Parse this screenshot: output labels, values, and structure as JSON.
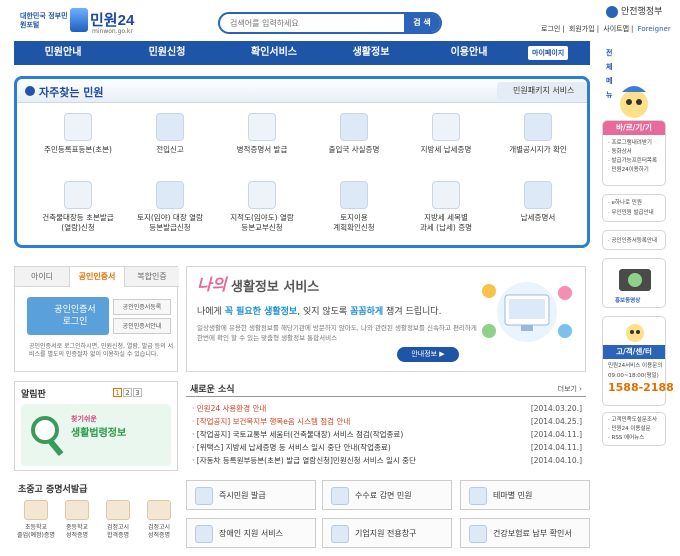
{
  "header": {
    "logo_small": "대한민국 정부민원포털",
    "logo_big": "민원24",
    "logo_url": "minwon.go.kr",
    "search_placeholder": "검색어를 입력하세요",
    "search_button": "검 색",
    "gov_name": "안전행정부",
    "top_links": [
      "로그인",
      "회원가입",
      "사이트맵",
      "Foreigner"
    ]
  },
  "nav": {
    "items": [
      "민원안내",
      "민원신청",
      "확인서비스",
      "생활정보",
      "이용안내"
    ],
    "my_page": "마이페이지",
    "all_menu": "전체메뉴"
  },
  "frequent": {
    "title": "자주찾는 민원",
    "package_link": "민원패키지 서비스",
    "services": [
      {
        "label": "주민등록표등본(초본)",
        "icon": "document-id-icon"
      },
      {
        "label": "전입신고",
        "icon": "house-move-icon"
      },
      {
        "label": "병적증명서 발급",
        "icon": "monitor-certificate-icon"
      },
      {
        "label": "출입국 사실증명",
        "icon": "airplane-icon"
      },
      {
        "label": "지방세 납세증명",
        "icon": "tax-doc-icon"
      },
      {
        "label": "개별공시지가 확인",
        "icon": "land-price-icon"
      },
      {
        "label": "건축물대장등 초본발급\n(열람)신청",
        "icon": "building-icon"
      },
      {
        "label": "토지(임야) 대장 열람\n등본발급신청",
        "icon": "land-search-icon"
      },
      {
        "label": "지적도(임야도) 열람\n등본교부신청",
        "icon": "map-monitor-icon"
      },
      {
        "label": "토지이용\n계획확인신청",
        "icon": "land-plan-icon"
      },
      {
        "label": "지방세 세목별\n과세 (납세) 증명",
        "icon": "money-stack-icon"
      },
      {
        "label": "납세증명서",
        "icon": "calculator-icon"
      }
    ]
  },
  "login": {
    "tabs": [
      "아이디",
      "공인인증서",
      "복합인증"
    ],
    "cert_login": "공인인증서\n로그인",
    "cert_register": "공인인증서등록",
    "cert_guide": "공인인증서안내",
    "note": "공인인증서로 로그인하시면, 민원신청, 열람, 발급 등의 서비스를 별도의 인증절차 없이 이용하실 수 있습니다."
  },
  "life_info": {
    "prefix": "나의",
    "title": "생활정보 서비스",
    "sub_before": "나에게 ",
    "sub_em1": "꼭 필요한 생활정보",
    "sub_mid": ", 잊지 않도록 ",
    "sub_em2": "꼼꼼하게",
    "sub_after": " 챙겨 드립니다.",
    "desc": "일상생활에 유용한 생활정보를 해당기관에 방문하지 않아도, 나와 관련된 생활정보를 신속하고 편리하게 한번에 확인 할 수 있는 맞춤형 생활정보 통합서비스",
    "more": "안내정보 ▶"
  },
  "notice": {
    "title": "알림판",
    "pages": [
      "1",
      "2",
      "3"
    ],
    "banner_top": "찾기쉬운",
    "banner_main": "생활법령정보"
  },
  "news": {
    "title": "새로운 소식",
    "more": "더보기 ›",
    "items": [
      {
        "text": "· 민원24 사용환경 안내",
        "date": "[2014.03.20.]",
        "hi": true
      },
      {
        "text": "· [작업공지] 보건복지부 행복e음 시스템 점검 안내",
        "date": "[2014.04.25.]",
        "hi": true
      },
      {
        "text": "· [작업공지] 국토교통부 세움터(건축물대장) 서비스 점검(작업종료)",
        "date": "[2014.04.11.]",
        "hi": false
      },
      {
        "text": "· [위택스] 지방세 납세증명 등 서비스 일시 중단 안내(작업종료)",
        "date": "[2014.04.11.]",
        "hi": false
      },
      {
        "text": "· [자동차 등록원부등본(초본) 발급 열람신청]민원신청 서비스 일시 중단",
        "date": "[2014.04.10.]",
        "hi": false
      }
    ]
  },
  "proof": {
    "title": "초중고 증명서발급",
    "items": [
      "초등학교\n졸업(예정)증명",
      "중등학교\n성적증명",
      "검정고시\n합격증명",
      "검정고시\n성적증명"
    ]
  },
  "quick": [
    "즉시민원 발급",
    "수수료 감면 민원",
    "테마별 민원",
    "장애인 지원 서비스",
    "기업지원 전용창구",
    "건강보험료 납부 확인서"
  ],
  "right": {
    "rule_title": "바/르/기/기",
    "rule_links": [
      "· 프로그램내려받기",
      "· 동화상서",
      "· 발급가능프린터목록",
      "· 민원24이용하기"
    ],
    "links2": [
      "· e하나로 민원",
      "· 무인민원 발급안내"
    ],
    "links3": [
      "· 공인인증서등록안내"
    ],
    "promo": "홍보동영상",
    "center_title": "고/객/센/터",
    "center_desc": "민원24서비스 이용문의",
    "center_hours": "09:00~18:00(평일)",
    "center_phone": "1588-2188",
    "links4": [
      "· 고객민족도설문조사",
      "· 민원24 이용설문",
      "· RSS 에어뉴스"
    ]
  },
  "colors": {
    "brand": "#1e55a6",
    "accent": "#e07000",
    "frame": "#2a7fd0"
  }
}
